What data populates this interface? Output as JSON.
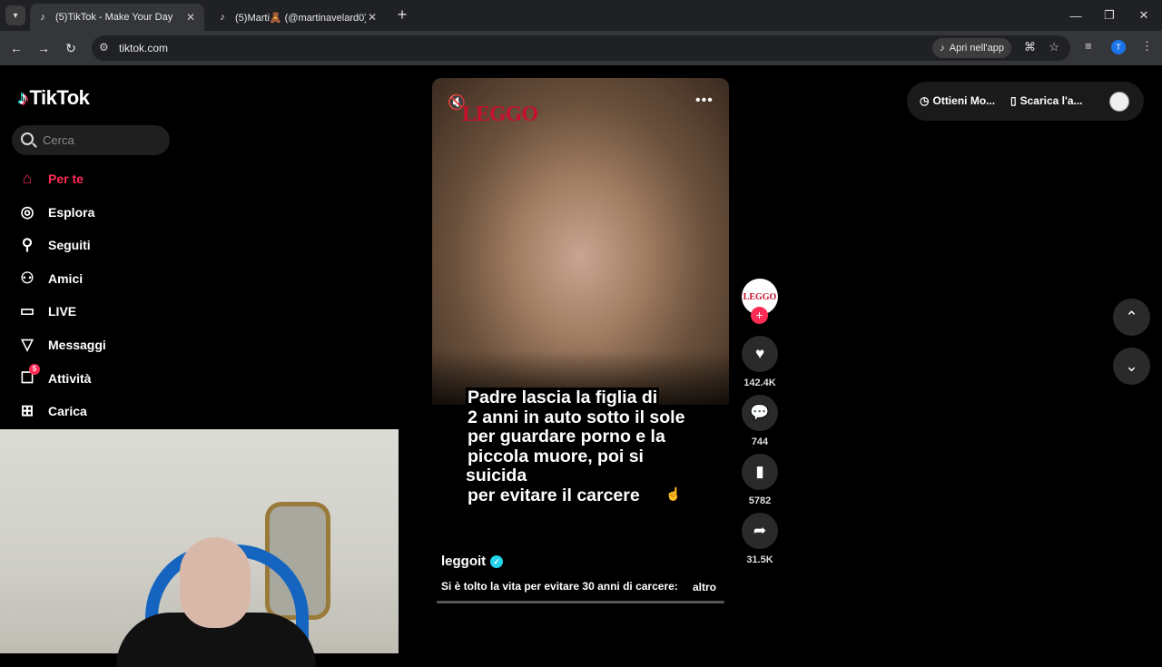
{
  "browser": {
    "tabs": [
      {
        "title": "(5)TikTok - Make Your Day",
        "active": true
      },
      {
        "title": "(5)Marti🧸 (@martinavelard0) |",
        "active": false
      }
    ],
    "url": "tiktok.com",
    "open_in_app_label": "Apri nell'app",
    "profile_initial": "T"
  },
  "sidebar": {
    "logo_text": "TikTok",
    "search_placeholder": "Cerca",
    "items": [
      {
        "label": "Per te",
        "icon": "home-icon",
        "active": true
      },
      {
        "label": "Esplora",
        "icon": "compass-icon"
      },
      {
        "label": "Seguiti",
        "icon": "following-icon"
      },
      {
        "label": "Amici",
        "icon": "friends-icon"
      },
      {
        "label": "LIVE",
        "icon": "live-icon"
      },
      {
        "label": "Messaggi",
        "icon": "messages-icon"
      },
      {
        "label": "Attività",
        "icon": "activity-icon",
        "badge": "5"
      },
      {
        "label": "Carica",
        "icon": "upload-icon"
      }
    ]
  },
  "video": {
    "brand_logo": "LEGGO",
    "caption_lines": [
      "Padre lascia la figlia di",
      "2 anni in auto sotto il sole",
      "per guardare porno e la",
      "piccola muore, poi si suicida",
      "per evitare il carcere"
    ],
    "author": "leggoit",
    "description": "Si è tolto la vita per evitare 30 anni di carcere:",
    "more_label": "altro",
    "progress": 0.0
  },
  "actions": {
    "avatar_text": "LEGGO",
    "likes": "142.4K",
    "comments": "744",
    "saves": "5782",
    "shares": "31.5K"
  },
  "top_right": {
    "get_coins_label": "Ottieni Mo...",
    "download_label": "Scarica l'a..."
  },
  "colors": {
    "accent": "#fe2c55",
    "leggo_red": "#c8102e",
    "verified": "#20d5ec"
  }
}
